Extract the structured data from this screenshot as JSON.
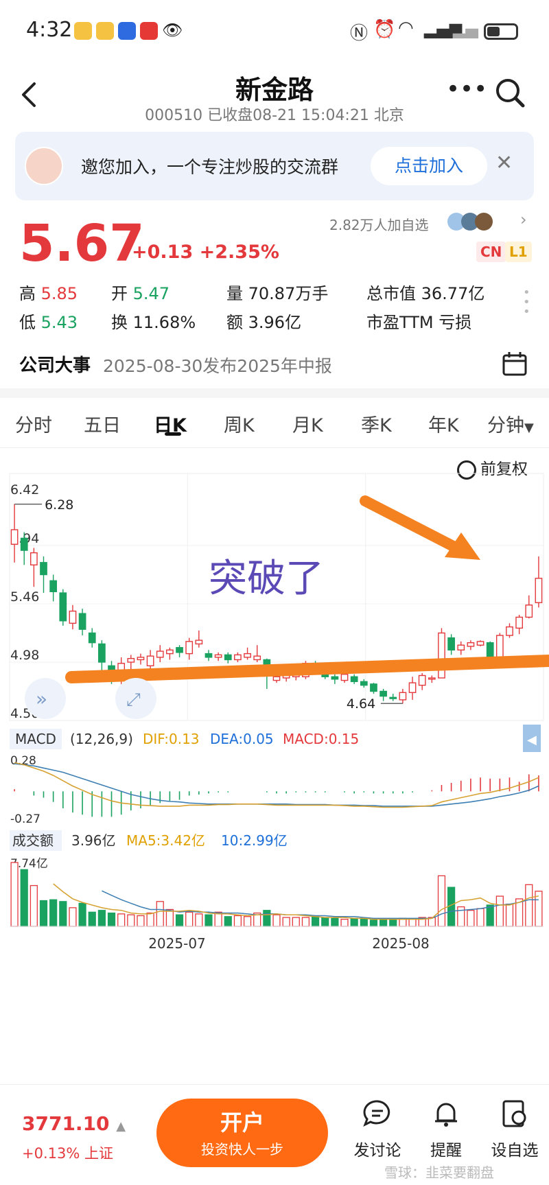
{
  "status_bar": {
    "time": "4:32"
  },
  "header": {
    "title": "新金路",
    "subtitle": "000510 已收盘08-21 15:04:21 北京"
  },
  "banner": {
    "text": "邀您加入，一个专注炒股的交流群",
    "button": "点击加入"
  },
  "quote": {
    "price": "5.67",
    "change": "+0.13  +2.35%",
    "followers": "2.82万人加自选",
    "badges": [
      "CN",
      "L1"
    ],
    "stats": {
      "high_label": "高",
      "high": "5.85",
      "open_label": "开",
      "open": "5.47",
      "volume": "量 70.87万手",
      "market_cap": "总市值 36.77亿",
      "low_label": "低",
      "low": "5.43",
      "turnover": "换 11.68%",
      "amount": "额 3.96亿",
      "pe": "市盈TTM 亏损"
    }
  },
  "event": {
    "label": "公司大事",
    "text": "2025-08-30发布2025年中报"
  },
  "tabs": [
    "分时",
    "五日",
    "日K",
    "周K",
    "月K",
    "季K",
    "年K",
    "分钟"
  ],
  "active_tab": "日K",
  "adjust_label": "前复权",
  "annotation": "突破了",
  "chart_data": [
    {
      "type": "candlestick",
      "y_ticks": [
        "6.42",
        "5.94",
        "5.46",
        "4.98",
        "4.50"
      ],
      "ylim": [
        4.5,
        6.42
      ],
      "x_ticks": [
        "2025-07",
        "2025-08"
      ],
      "max_marker": "6.28",
      "min_marker": "4.64",
      "candles": [
        {
          "o": 5.95,
          "c": 6.07,
          "h": 6.28,
          "l": 5.8
        },
        {
          "o": 6.0,
          "c": 5.9,
          "h": 6.05,
          "l": 5.78
        },
        {
          "o": 5.78,
          "c": 5.88,
          "h": 5.92,
          "l": 5.6
        },
        {
          "o": 5.8,
          "c": 5.7,
          "h": 5.85,
          "l": 5.55
        },
        {
          "o": 5.65,
          "c": 5.56,
          "h": 5.7,
          "l": 5.48
        },
        {
          "o": 5.55,
          "c": 5.32,
          "h": 5.58,
          "l": 5.28
        },
        {
          "o": 5.3,
          "c": 5.4,
          "h": 5.45,
          "l": 5.25
        },
        {
          "o": 5.38,
          "c": 5.25,
          "h": 5.42,
          "l": 5.2
        },
        {
          "o": 5.22,
          "c": 5.14,
          "h": 5.26,
          "l": 5.1
        },
        {
          "o": 5.13,
          "c": 4.98,
          "h": 5.16,
          "l": 4.9
        },
        {
          "o": 4.95,
          "c": 4.88,
          "h": 4.99,
          "l": 4.8
        },
        {
          "o": 4.85,
          "c": 4.97,
          "h": 5.02,
          "l": 4.78
        },
        {
          "o": 4.98,
          "c": 5.01,
          "h": 5.04,
          "l": 4.92
        },
        {
          "o": 5.0,
          "c": 5.02,
          "h": 5.05,
          "l": 4.96
        },
        {
          "o": 4.95,
          "c": 5.03,
          "h": 5.08,
          "l": 4.9
        },
        {
          "o": 5.02,
          "c": 5.07,
          "h": 5.12,
          "l": 4.98
        },
        {
          "o": 5.05,
          "c": 5.08,
          "h": 5.1,
          "l": 5.0
        },
        {
          "o": 5.1,
          "c": 5.06,
          "h": 5.12,
          "l": 5.02
        },
        {
          "o": 5.05,
          "c": 5.15,
          "h": 5.18,
          "l": 5.0
        },
        {
          "o": 5.13,
          "c": 5.16,
          "h": 5.24,
          "l": 5.1
        },
        {
          "o": 5.05,
          "c": 5.02,
          "h": 5.08,
          "l": 4.99
        },
        {
          "o": 5.02,
          "c": 5.04,
          "h": 5.06,
          "l": 4.99
        },
        {
          "o": 5.04,
          "c": 5.0,
          "h": 5.06,
          "l": 4.97
        },
        {
          "o": 5.0,
          "c": 5.04,
          "h": 5.06,
          "l": 4.98
        },
        {
          "o": 5.02,
          "c": 5.05,
          "h": 5.1,
          "l": 5.0
        },
        {
          "o": 5.0,
          "c": 5.03,
          "h": 5.12,
          "l": 4.98
        },
        {
          "o": 5.0,
          "c": 4.88,
          "h": 5.01,
          "l": 4.76
        },
        {
          "o": 4.83,
          "c": 4.86,
          "h": 4.88,
          "l": 4.81
        },
        {
          "o": 4.85,
          "c": 4.87,
          "h": 4.89,
          "l": 4.82
        },
        {
          "o": 4.86,
          "c": 4.88,
          "h": 4.9,
          "l": 4.83
        },
        {
          "o": 4.86,
          "c": 4.97,
          "h": 4.99,
          "l": 4.84
        },
        {
          "o": 4.96,
          "c": 4.92,
          "h": 4.99,
          "l": 4.9
        },
        {
          "o": 4.93,
          "c": 4.86,
          "h": 4.95,
          "l": 4.84
        },
        {
          "o": 4.86,
          "c": 4.84,
          "h": 4.88,
          "l": 4.8
        },
        {
          "o": 4.83,
          "c": 4.88,
          "h": 4.89,
          "l": 4.81
        },
        {
          "o": 4.86,
          "c": 4.82,
          "h": 4.88,
          "l": 4.8
        },
        {
          "o": 4.82,
          "c": 4.79,
          "h": 4.84,
          "l": 4.77
        },
        {
          "o": 4.8,
          "c": 4.74,
          "h": 4.81,
          "l": 4.72
        },
        {
          "o": 4.74,
          "c": 4.7,
          "h": 4.76,
          "l": 4.66
        },
        {
          "o": 4.69,
          "c": 4.68,
          "h": 4.72,
          "l": 4.66
        },
        {
          "o": 4.67,
          "c": 4.73,
          "h": 4.76,
          "l": 4.64
        },
        {
          "o": 4.73,
          "c": 4.81,
          "h": 4.86,
          "l": 4.67
        },
        {
          "o": 4.79,
          "c": 4.87,
          "h": 4.89,
          "l": 4.75
        },
        {
          "o": 4.84,
          "c": 4.85,
          "h": 4.87,
          "l": 4.81
        },
        {
          "o": 4.85,
          "c": 5.22,
          "h": 5.26,
          "l": 4.85
        },
        {
          "o": 5.18,
          "c": 5.08,
          "h": 5.21,
          "l": 5.04
        },
        {
          "o": 5.08,
          "c": 5.12,
          "h": 5.15,
          "l": 5.04
        },
        {
          "o": 5.11,
          "c": 5.14,
          "h": 5.16,
          "l": 5.08
        },
        {
          "o": 5.12,
          "c": 5.15,
          "h": 5.16,
          "l": 5.11
        },
        {
          "o": 5.14,
          "c": 5.02,
          "h": 5.15,
          "l": 5.01
        },
        {
          "o": 5.02,
          "c": 5.2,
          "h": 5.22,
          "l": 5.01
        },
        {
          "o": 5.2,
          "c": 5.27,
          "h": 5.3,
          "l": 5.18
        },
        {
          "o": 5.26,
          "c": 5.35,
          "h": 5.37,
          "l": 5.21
        },
        {
          "o": 5.35,
          "c": 5.45,
          "h": 5.53,
          "l": 5.34
        },
        {
          "o": 5.47,
          "c": 5.67,
          "h": 5.85,
          "l": 5.43
        }
      ]
    },
    {
      "type": "line",
      "title": "MACD",
      "params": "(12,26,9)",
      "dif_label": "DIF:0.13",
      "dea_label": "DEA:0.05",
      "macd_label": "MACD:0.15",
      "y_ticks": [
        "0.28",
        "-0.27"
      ],
      "ylim": [
        -0.27,
        0.28
      ],
      "dif": [
        0.27,
        0.25,
        0.22,
        0.19,
        0.15,
        0.1,
        0.05,
        0.01,
        -0.03,
        -0.06,
        -0.09,
        -0.11,
        -0.12,
        -0.13,
        -0.135,
        -0.14,
        -0.14,
        -0.14,
        -0.13,
        -0.13,
        -0.13,
        -0.125,
        -0.125,
        -0.12,
        -0.12,
        -0.12,
        -0.125,
        -0.13,
        -0.13,
        -0.13,
        -0.13,
        -0.13,
        -0.13,
        -0.13,
        -0.135,
        -0.14,
        -0.14,
        -0.145,
        -0.15,
        -0.15,
        -0.15,
        -0.145,
        -0.14,
        -0.135,
        -0.1,
        -0.08,
        -0.06,
        -0.04,
        -0.02,
        -0.01,
        0.01,
        0.03,
        0.06,
        0.09,
        0.13
      ],
      "dea": [
        0.26,
        0.25,
        0.24,
        0.22,
        0.2,
        0.18,
        0.15,
        0.12,
        0.09,
        0.06,
        0.03,
        0.0,
        -0.03,
        -0.05,
        -0.07,
        -0.085,
        -0.095,
        -0.1,
        -0.11,
        -0.115,
        -0.12,
        -0.12,
        -0.12,
        -0.12,
        -0.12,
        -0.12,
        -0.12,
        -0.12,
        -0.12,
        -0.125,
        -0.125,
        -0.125,
        -0.125,
        -0.13,
        -0.13,
        -0.13,
        -0.135,
        -0.135,
        -0.14,
        -0.14,
        -0.14,
        -0.14,
        -0.14,
        -0.14,
        -0.13,
        -0.12,
        -0.11,
        -0.1,
        -0.085,
        -0.07,
        -0.05,
        -0.035,
        -0.015,
        0.01,
        0.05
      ],
      "hist": [
        0.02,
        0.0,
        -0.04,
        -0.06,
        -0.1,
        -0.16,
        -0.2,
        -0.22,
        -0.24,
        -0.24,
        -0.24,
        -0.22,
        -0.18,
        -0.16,
        -0.13,
        -0.11,
        -0.09,
        -0.08,
        -0.04,
        -0.03,
        -0.02,
        -0.01,
        -0.01,
        0.0,
        0.0,
        0.0,
        -0.01,
        -0.02,
        -0.02,
        -0.01,
        -0.01,
        -0.01,
        -0.01,
        0.0,
        -0.01,
        -0.02,
        -0.01,
        -0.02,
        -0.02,
        -0.02,
        -0.02,
        -0.01,
        0.0,
        0.01,
        0.06,
        0.08,
        0.1,
        0.12,
        0.13,
        0.12,
        0.12,
        0.13,
        0.09,
        0.16,
        0.15
      ]
    },
    {
      "type": "bar",
      "title": "成交额",
      "value_label": "3.96亿",
      "ma5_label": "MA5:3.42亿",
      "ma10_label": "10:2.99亿",
      "y_ticks": [
        "7.74亿"
      ],
      "ylim": [
        0,
        7.74
      ],
      "values": [
        7.2,
        6.4,
        4.6,
        2.9,
        3.0,
        2.8,
        2.1,
        2.6,
        1.6,
        1.8,
        1.5,
        1.4,
        1.3,
        1.2,
        1.5,
        2.8,
        1.9,
        1.3,
        1.6,
        1.4,
        1.3,
        1.6,
        1.1,
        1.2,
        1.1,
        1.5,
        1.8,
        1.3,
        1.0,
        1.0,
        1.0,
        1.1,
        1.0,
        0.9,
        0.8,
        0.9,
        0.8,
        0.7,
        0.7,
        0.8,
        0.9,
        0.8,
        1.0,
        1.0,
        5.7,
        4.4,
        2.2,
        1.8,
        2.0,
        2.4,
        3.4,
        2.5,
        3.1,
        4.7,
        3.96
      ],
      "ma5": [
        null,
        null,
        null,
        null,
        4.8,
        3.9,
        3.1,
        2.7,
        2.4,
        2.1,
        1.9,
        1.8,
        1.5,
        1.4,
        1.4,
        1.7,
        1.7,
        1.7,
        1.8,
        1.7,
        1.5,
        1.4,
        1.4,
        1.3,
        1.2,
        1.3,
        1.3,
        1.4,
        1.3,
        1.3,
        1.2,
        1.1,
        1.0,
        1.0,
        1.0,
        0.9,
        0.9,
        0.8,
        0.8,
        0.8,
        0.8,
        0.8,
        0.8,
        0.9,
        1.9,
        2.4,
        2.9,
        3.0,
        3.2,
        2.6,
        2.4,
        2.4,
        2.7,
        3.2,
        3.42
      ],
      "ma10": [
        null,
        null,
        null,
        null,
        null,
        null,
        null,
        null,
        null,
        4.0,
        3.5,
        3.0,
        2.6,
        2.2,
        1.9,
        1.9,
        1.8,
        1.6,
        1.7,
        1.6,
        1.6,
        1.5,
        1.5,
        1.5,
        1.4,
        1.3,
        1.4,
        1.4,
        1.3,
        1.3,
        1.3,
        1.2,
        1.2,
        1.1,
        1.1,
        1.1,
        1.0,
        0.9,
        0.9,
        0.9,
        0.9,
        0.9,
        0.9,
        0.9,
        1.4,
        1.7,
        1.8,
        1.9,
        2.0,
        2.2,
        2.4,
        2.5,
        2.7,
        3.0,
        2.99
      ]
    }
  ],
  "bottom_bar": {
    "index_value": "3771.10",
    "index_change": "+0.13% 上证",
    "open_title": "开户",
    "open_sub": "投资快人一步",
    "discuss": "发讨论",
    "remind": "提醒",
    "watchlist": "设自选",
    "watermark": "雪球：韭菜要翻盘"
  },
  "colors": {
    "up": "#e4393c",
    "down": "#1aa260",
    "accent": "#ff6a13",
    "link": "#1e6fd9"
  }
}
